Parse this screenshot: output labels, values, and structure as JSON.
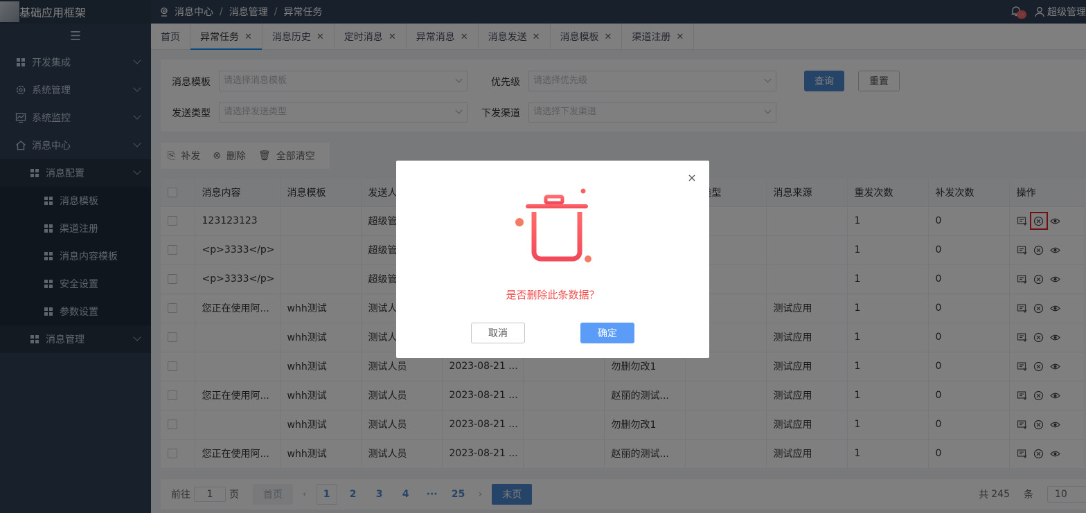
{
  "app": {
    "title": "基础应用框架"
  },
  "sidebar": {
    "items": [
      {
        "label": "开发集成",
        "icon": "grid-icon"
      },
      {
        "label": "系统管理",
        "icon": "gear-icon"
      },
      {
        "label": "系统监控",
        "icon": "monitor-icon"
      },
      {
        "label": "消息中心",
        "icon": "home-icon"
      }
    ],
    "msg_config": "消息配置",
    "sub_items": [
      "消息模板",
      "渠道注册",
      "消息内容模板",
      "安全设置",
      "参数设置"
    ],
    "msg_manage": "消息管理"
  },
  "header": {
    "breadcrumb": [
      "消息中心",
      "消息管理",
      "异常任务"
    ],
    "bell_badge": "...",
    "user": "超级管理"
  },
  "tabs": [
    {
      "label": "首页",
      "closable": false
    },
    {
      "label": "异常任务",
      "closable": true,
      "active": true
    },
    {
      "label": "消息历史",
      "closable": true
    },
    {
      "label": "定时消息",
      "closable": true
    },
    {
      "label": "异常消息",
      "closable": true
    },
    {
      "label": "消息发送",
      "closable": true
    },
    {
      "label": "消息模板",
      "closable": true
    },
    {
      "label": "渠道注册",
      "closable": true
    }
  ],
  "search": {
    "template_label": "消息模板",
    "template_placeholder": "请选择消息模板",
    "priority_label": "优先级",
    "priority_placeholder": "请选择优先级",
    "send_type_label": "发送类型",
    "send_type_placeholder": "请选择发送类型",
    "channel_label": "下发渠道",
    "channel_placeholder": "请选择下发渠道",
    "query_btn": "查询",
    "reset_btn": "重置"
  },
  "actions": {
    "resend": "补发",
    "delete": "删除",
    "clear_all": "全部清空"
  },
  "table": {
    "headers": [
      "消息内容",
      "消息模板",
      "发送人",
      "",
      "",
      "",
      "送类型",
      "消息来源",
      "重发次数",
      "补发次数",
      "操作"
    ],
    "rows": [
      [
        "123123123",
        "",
        "超级管",
        "",
        "",
        "",
        "",
        "",
        "1",
        "0"
      ],
      [
        "<p>3333</p>",
        "",
        "超级管",
        "",
        "",
        "",
        "",
        "",
        "1",
        "0"
      ],
      [
        "<p>3333</p>",
        "",
        "超级管",
        "",
        "",
        "",
        "",
        "",
        "1",
        "0"
      ],
      [
        "您正在使用阿...",
        "whh测试",
        "测试人",
        "",
        "",
        "",
        "",
        "测试应用",
        "1",
        "0"
      ],
      [
        "",
        "whh测试",
        "测试人",
        "",
        "",
        "",
        "",
        "测试应用",
        "1",
        "0"
      ],
      [
        "",
        "whh测试",
        "测试人员",
        "2023-08-21 ...",
        "",
        "勿删勿改1",
        "",
        "测试应用",
        "1",
        "0"
      ],
      [
        "您正在使用阿...",
        "whh测试",
        "测试人员",
        "2023-08-21 ...",
        "",
        "赵丽的测试...",
        "",
        "测试应用",
        "1",
        "0"
      ],
      [
        "",
        "whh测试",
        "测试人员",
        "2023-08-21 ...",
        "",
        "勿删勿改1",
        "",
        "测试应用",
        "1",
        "0"
      ],
      [
        "您正在使用阿...",
        "whh测试",
        "测试人员",
        "2023-08-21 ...",
        "",
        "赵丽的测试...",
        "",
        "测试应用",
        "1",
        "0"
      ]
    ]
  },
  "pager": {
    "goto_prefix": "前往",
    "goto_value": "1",
    "goto_suffix": "页",
    "first": "首页",
    "pages": [
      "1",
      "2",
      "3",
      "4",
      "···",
      "25"
    ],
    "last": "末页",
    "total_prefix": "共",
    "total": "245",
    "total_suffix": "条",
    "page_size": "10"
  },
  "dialog": {
    "message": "是否删除此条数据？",
    "cancel": "取消",
    "confirm": "确定"
  },
  "colors": {
    "sidebar": "#304156",
    "primary": "#4d88cf",
    "danger": "#f05050"
  }
}
